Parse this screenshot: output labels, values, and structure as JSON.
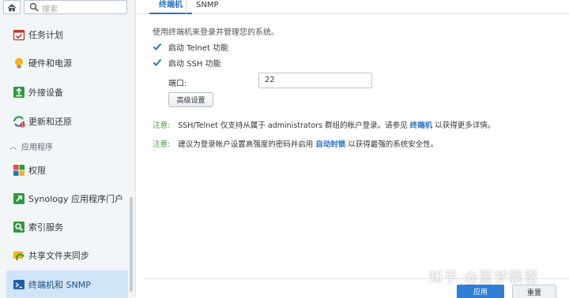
{
  "sidebar": {
    "search_placeholder": "搜索",
    "items": [
      {
        "label": "任务计划",
        "icon": "task-scheduler-icon"
      },
      {
        "label": "硬件和电源",
        "icon": "hardware-power-icon"
      },
      {
        "label": "外接设备",
        "icon": "external-devices-icon"
      },
      {
        "label": "更新和还原",
        "icon": "update-restore-icon"
      },
      {
        "label": "权限",
        "icon": "privileges-icon"
      },
      {
        "label": "Synology 应用程序门户",
        "icon": "application-portal-icon"
      },
      {
        "label": "索引服务",
        "icon": "indexing-service-icon"
      },
      {
        "label": "共享文件夹同步",
        "icon": "shared-folder-sync-icon"
      },
      {
        "label": "终端机和 SNMP",
        "icon": "terminal-snmp-icon"
      }
    ],
    "group_label": "应用程序",
    "active_index": 8
  },
  "tabs": [
    {
      "label": "终端机",
      "active": true
    },
    {
      "label": "SNMP",
      "active": false
    }
  ],
  "main": {
    "description": "使用终端机来登录并管理您的系统。",
    "telnet_label": "启动 Telnet 功能",
    "telnet_checked": true,
    "ssh_label": "启动 SSH 功能",
    "ssh_checked": true,
    "port_label": "端口:",
    "port_value": "22",
    "advanced_button": "高级设置",
    "note1": {
      "label": "注意:",
      "text_before": "SSH/Telnet 仅支持从属于 administrators 群组的帐户登录。请参见",
      "link": "终端机",
      "text_after": "以获得更多详情。"
    },
    "note2": {
      "label": "注意:",
      "text_before": "建议为登录帐户设置高强度的密码并启用",
      "link": "自动封锁",
      "text_after": "以获得最强的系统安全性。"
    }
  },
  "footer": {
    "apply_label": "应用",
    "reset_label": "重置"
  },
  "watermark": "知乎 @噩梦飘雷",
  "colors": {
    "accent": "#2a73c6",
    "note_green": "#3f9f3f",
    "sidebar_bg": "#f3f6f9",
    "active_item_bg": "#cfe4f7",
    "apply_button": "#2f7ed8"
  }
}
